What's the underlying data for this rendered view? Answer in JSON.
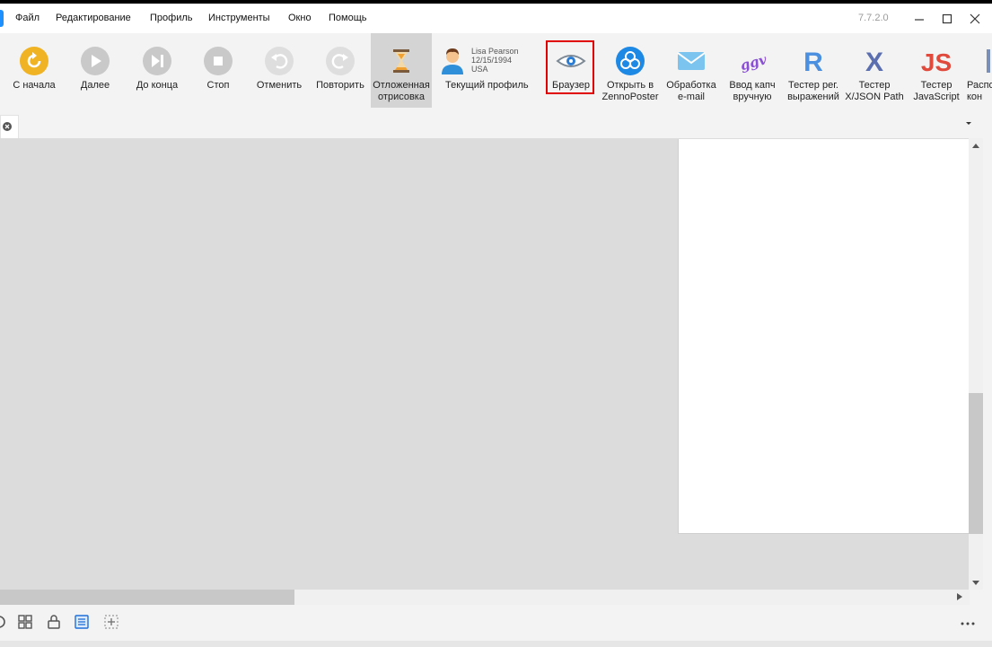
{
  "menu": {
    "items": [
      "Файл",
      "Редактирование",
      "Профиль",
      "Инструменты",
      "Окно",
      "Помощь"
    ],
    "version": "7.7.2.0"
  },
  "toolbar": {
    "restart": "С начала",
    "next": "Далее",
    "to_end": "До конца",
    "stop": "Стоп",
    "undo": "Отменить",
    "redo": "Повторить",
    "deferred_render": "Отложенная\nотрисовка",
    "current_profile": "Текущий профиль",
    "browser": "Браузер",
    "open_zennoposter": "Открыть в\nZennoPoster",
    "email_processing": "Обработка\ne-mail",
    "captcha_manual": "Ввод капч\nвручную",
    "regex_tester": "Тестер рег.\nвыражений",
    "xjson_tester": "Тестер\nX/JSON Path",
    "js_tester": "Тестер\nJavaScript",
    "cut_off": "Распо\nкон"
  },
  "profile": {
    "name": "Lisa Pearson",
    "birthdate": "12/15/1994",
    "country": "USA"
  },
  "colors": {
    "accent_orange": "#f0b323",
    "accent_blue": "#1e88e5",
    "regex_blue": "#4a8fe0",
    "xpath_blue": "#5b6fb0",
    "js_red": "#e04a3c",
    "captcha_purple": "#8a4fd6",
    "highlight_red": "#e00000"
  }
}
